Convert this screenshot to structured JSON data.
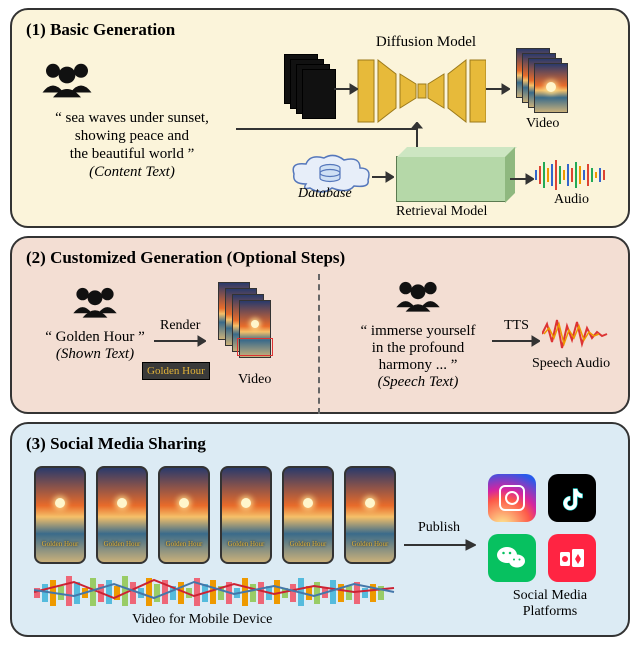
{
  "panel1": {
    "title": "(1) Basic Generation",
    "content_text_l1": "“ sea waves under sunset,",
    "content_text_l2": "showing peace and",
    "content_text_l3": "the beautiful world ”",
    "content_text_caption": "(Content Text)",
    "diffusion_label": "Diffusion Model",
    "video_label": "Video",
    "database_label": "Database",
    "retrieval_label": "Retrieval Model",
    "audio_label": "Audio"
  },
  "panel2": {
    "title": "(2) Customized Generation (Optional Steps)",
    "shown_text_line": "“ Golden Hour ”",
    "shown_text_caption": "(Shown Text)",
    "render_label": "Render",
    "golden_chip": "Golden Hour",
    "video_label": "Video",
    "speech_text_l1": "“ immerse yourself",
    "speech_text_l2": "in the profound",
    "speech_text_l3": "harmony ... ”",
    "speech_text_caption": "(Speech Text)",
    "tts_label": "TTS",
    "speech_audio_label": "Speech Audio"
  },
  "panel3": {
    "title": "(3) Social Media Sharing",
    "phone_caption": "Golden Hour",
    "video_mobile_label": "Video for Mobile Device",
    "publish_label": "Publish",
    "social_label_l1": "Social Media",
    "social_label_l2": "Platforms",
    "icons": {
      "instagram": "instagram-icon",
      "tiktok": "tiktok-icon",
      "wechat": "wechat-icon",
      "xiaohongshu": "xiaohongshu-icon"
    }
  }
}
